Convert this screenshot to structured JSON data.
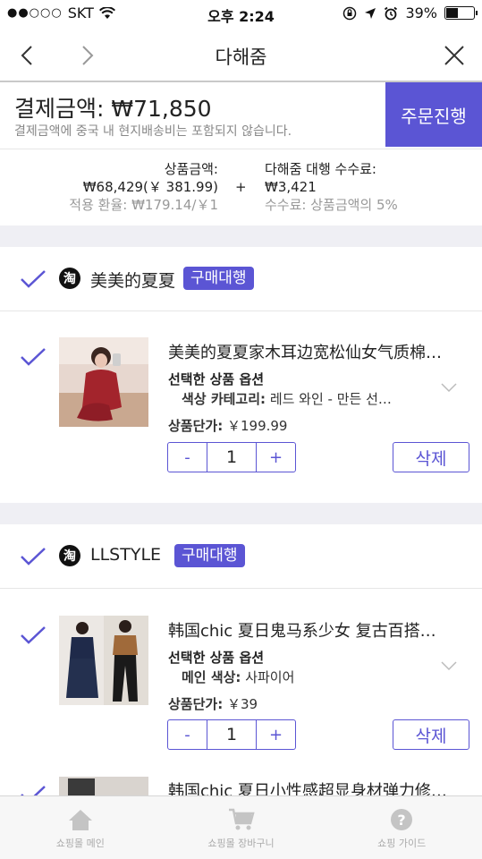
{
  "status_bar": {
    "carrier": "SKT",
    "time": "오후 2:24",
    "battery": "39%"
  },
  "nav": {
    "title": "다해줌",
    "back_icon": "chevron-left-icon",
    "forward_icon": "chevron-right-icon",
    "close_icon": "close-icon"
  },
  "summary": {
    "total_label": "결제금액:",
    "total_amount": "₩71,850",
    "note": "결제금액에 중국 내 현지배송비는 포함되지 않습니다.",
    "order_button": "주문진행",
    "product_label": "상품금액:",
    "product_amount": "₩68,429(￥ 381.99)",
    "exchange_rate": "적용 환율: ₩179.14/￥1",
    "plus": "+",
    "fee_label": "다해줌 대행 수수료:",
    "fee_amount": "₩3,421",
    "fee_note": "수수료: 상품금액의 5%"
  },
  "shops": [
    {
      "name": "美美的夏夏",
      "badge": "구매대행",
      "logo": "淘",
      "item": {
        "title": "美美的夏夏家木耳边宽松仙女气质棉…",
        "option_header": "선택한 상품 옵션",
        "option_key": "색상 카테고리:",
        "option_value": "레드 와인 - 만든 선…",
        "price_label": "상품단가:",
        "price": "￥199.99",
        "quantity": "1",
        "minus": "-",
        "plus": "+",
        "delete": "삭제"
      }
    },
    {
      "name": "LLSTYLE",
      "badge": "구매대행",
      "logo": "淘",
      "item": {
        "title": "韩国chic 夏日鬼马系少女 复古百搭…",
        "option_header": "선택한 상품 옵션",
        "option_key": "메인 색상:",
        "option_value": "사파이어",
        "price_label": "상품단가:",
        "price": "￥39",
        "quantity": "1",
        "minus": "-",
        "plus": "+",
        "delete": "삭제"
      }
    }
  ],
  "partial_item": {
    "title": "韩国chic 夏日小性感超显身材弹力修…"
  },
  "tabbar": [
    {
      "label": "쇼핑몰 메인",
      "icon": "home-icon"
    },
    {
      "label": "쇼핑몰 장바구니",
      "icon": "cart-icon"
    },
    {
      "label": "쇼핑 가이드",
      "icon": "help-icon"
    }
  ],
  "colors": {
    "accent": "#5b55d4",
    "separator": "#efeff4"
  }
}
